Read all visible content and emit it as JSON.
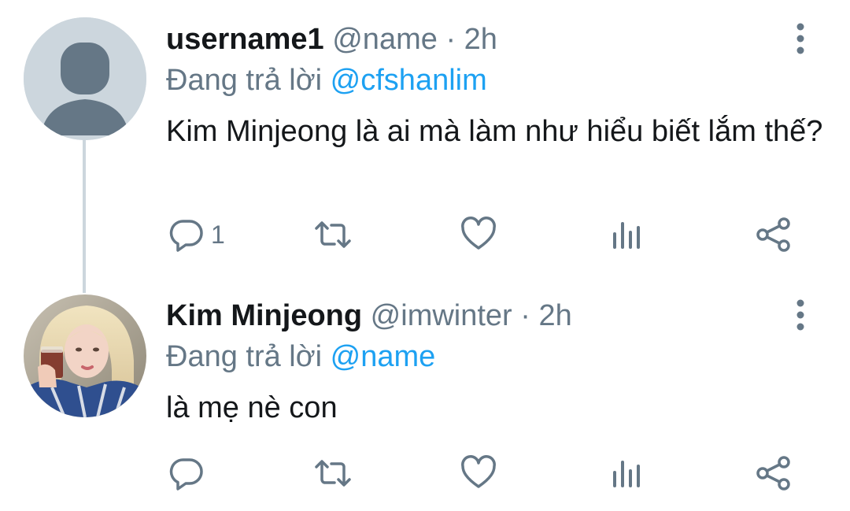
{
  "tweets": [
    {
      "display_name": "username1",
      "handle": "@name",
      "separator": "·",
      "time": "2h",
      "reply_prefix": "Đang trả lời",
      "reply_mention": "@cfshanlim",
      "text": "Kim Minjeong là ai mà làm như hiểu biết lắm thế?",
      "reply_count": "1",
      "avatar": "default-avatar-icon"
    },
    {
      "display_name": "Kim Minjeong",
      "handle": "@imwinter",
      "separator": "·",
      "time": "2h",
      "reply_prefix": "Đang trả lời",
      "reply_mention": "@name",
      "text": "là mẹ nè con",
      "reply_count": "",
      "avatar": "profile-photo"
    }
  ],
  "icons": {
    "reply": "reply-icon",
    "retweet": "retweet-icon",
    "like": "heart-icon",
    "analytics": "analytics-icon",
    "share": "share-icon",
    "more": "more-vertical-icon"
  },
  "colors": {
    "text": "#14171a",
    "secondary": "#657786",
    "accent": "#1da1f2",
    "thread_line": "#ccd6dd",
    "default_avatar_bg": "#ccd6dd",
    "default_avatar_fg": "#657786"
  }
}
